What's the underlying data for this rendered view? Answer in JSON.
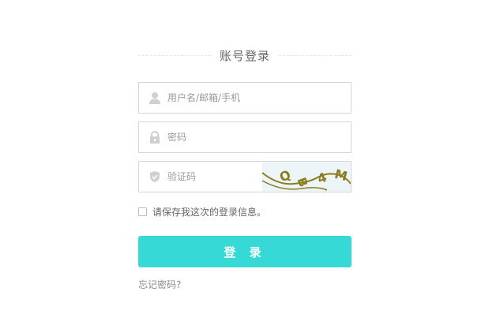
{
  "login": {
    "title": "账号登录",
    "username": {
      "placeholder": "用户名/邮箱/手机",
      "value": "",
      "icon": "user-icon"
    },
    "password": {
      "placeholder": "密码",
      "value": "",
      "icon": "lock-icon"
    },
    "captcha": {
      "placeholder": "验证码",
      "value": "",
      "icon": "shield-icon",
      "image_text": "QB4M"
    },
    "remember_label": "请保存我这次的登录信息。",
    "remember_checked": false,
    "submit_label": "登 录",
    "forgot_label": "忘记密码?"
  },
  "colors": {
    "accent": "#36d9d5",
    "border": "#d6d6d6",
    "icon": "#d0d0d0",
    "captcha_ink": "#8a7d1e"
  }
}
